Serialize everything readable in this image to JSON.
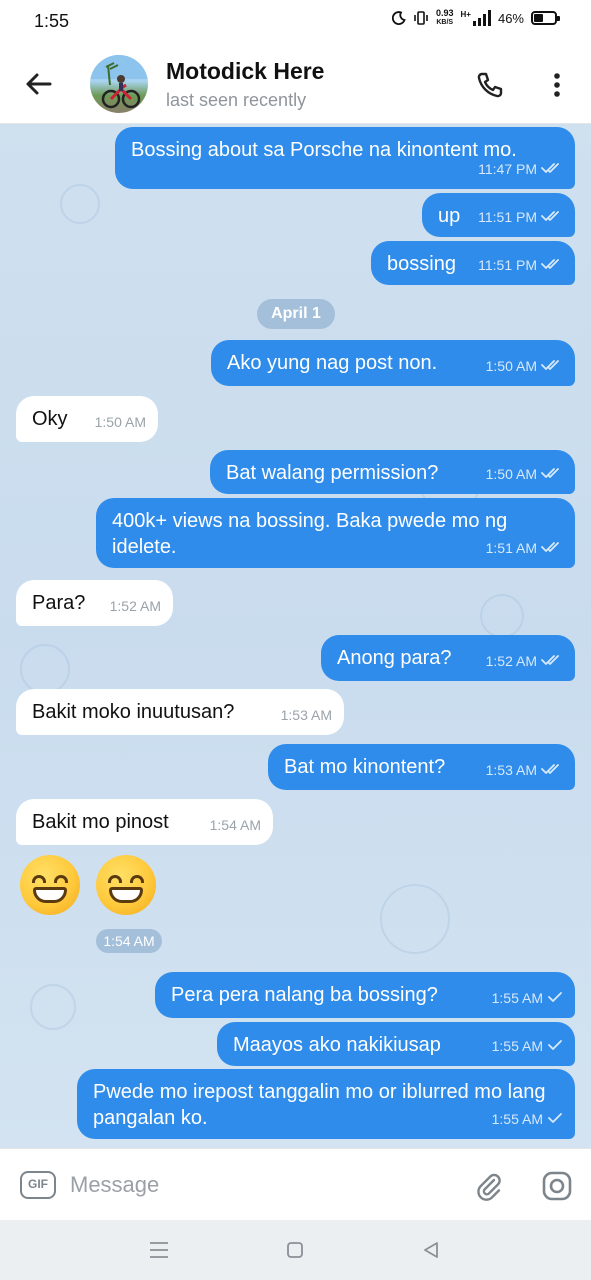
{
  "status_bar": {
    "time": "1:55",
    "net_speed": "0.93",
    "net_unit": "KB/S",
    "signal": "H+",
    "battery": "46%",
    "battery_level": 0.46
  },
  "header": {
    "contact_name": "Motodick Here",
    "contact_status": "last seen recently"
  },
  "chat": {
    "date_separator": "April 1",
    "messages": [
      {
        "dir": "out",
        "text": "Bossing about sa Porsche na kinontent mo.",
        "time": "11:47 PM",
        "receipt": "double-check"
      },
      {
        "dir": "out",
        "text": "up",
        "time": "11:51 PM",
        "receipt": "double-check"
      },
      {
        "dir": "out",
        "text": "bossing",
        "time": "11:51 PM",
        "receipt": "double-check"
      },
      {
        "dir": "out",
        "text": "Ako yung nag post non.",
        "time": "1:50 AM",
        "receipt": "double-check"
      },
      {
        "dir": "in",
        "text": "Oky",
        "time": "1:50 AM"
      },
      {
        "dir": "out",
        "text": "Bat walang permission?",
        "time": "1:50 AM",
        "receipt": "double-check"
      },
      {
        "dir": "out",
        "text": "400k+ views na bossing. Baka pwede mo ng idelete.",
        "time": "1:51 AM",
        "receipt": "double-check"
      },
      {
        "dir": "in",
        "text": "Para?",
        "time": "1:52 AM"
      },
      {
        "dir": "out",
        "text": "Anong para?",
        "time": "1:52 AM",
        "receipt": "double-check"
      },
      {
        "dir": "in",
        "text": "Bakit moko inuutusan?",
        "time": "1:53 AM"
      },
      {
        "dir": "out",
        "text": "Bat mo kinontent?",
        "time": "1:53 AM",
        "receipt": "double-check"
      },
      {
        "dir": "in",
        "text": "Bakit mo pinost",
        "time": "1:54 AM"
      },
      {
        "dir": "out",
        "text": "Pera pera nalang ba bossing?",
        "time": "1:55 AM",
        "receipt": "single-check"
      },
      {
        "dir": "out",
        "text": "Maayos ako nakikiusap",
        "time": "1:55 AM",
        "receipt": "single-check"
      },
      {
        "dir": "out",
        "text": "Pwede mo irepost tanggalin mo or iblurred mo lang pangalan ko.",
        "time": "1:55 AM",
        "receipt": "single-check"
      }
    ],
    "emoji_message": {
      "emoji": "grinning-face-with-smiling-eyes",
      "count": 2,
      "time": "1:54 AM"
    }
  },
  "input": {
    "gif_label": "GIF",
    "placeholder": "Message"
  },
  "icons": {
    "back": "arrow-left-icon",
    "call": "phone-icon",
    "more": "more-vertical-icon",
    "attach": "paperclip-icon",
    "camera": "camera-icon",
    "nav_menu": "menu-icon",
    "nav_home": "home-icon",
    "nav_back": "back-triangle-icon"
  },
  "colors": {
    "outgoing_bubble": "#2f8cea",
    "incoming_bubble": "#ffffff",
    "chat_background": "#cfe0ef"
  }
}
